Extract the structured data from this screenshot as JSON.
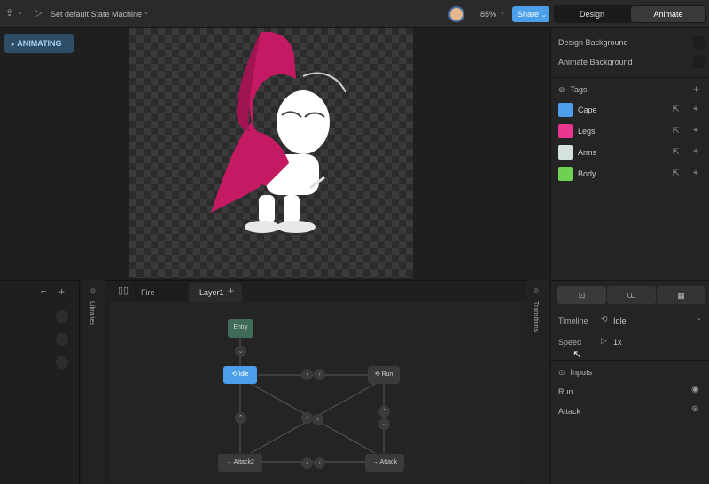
{
  "topbar": {
    "title": "Set default State Machine",
    "zoom": "85%",
    "share_label": "Share",
    "design_label": "Design",
    "animate_label": "Animate"
  },
  "stage": {
    "badge": "ANIMATING"
  },
  "right_panel": {
    "design_bg_label": "Design Background",
    "animate_bg_label": "Animate Background",
    "tags_title": "Tags",
    "tags": [
      {
        "label": "Cape",
        "color": "#4a9fe8"
      },
      {
        "label": "Legs",
        "color": "#e8368f"
      },
      {
        "label": "Arms",
        "color": "#d5e2dc"
      },
      {
        "label": "Body",
        "color": "#6fd150"
      }
    ],
    "timeline_label": "Timeline",
    "timeline_value": "Idle",
    "speed_label": "Speed",
    "speed_value": "1x",
    "inputs_title": "Inputs",
    "inputs": [
      {
        "label": "Run"
      },
      {
        "label": "Attack"
      }
    ]
  },
  "bottom": {
    "tab1": "Fire",
    "tab2": "Layer1",
    "libraries_label": "Libraries",
    "transitions_label": "Transitions",
    "nodes": {
      "entry": "Entry",
      "idle": "Idle",
      "run": "Run",
      "attack2": "Attack2",
      "attack": "Attack"
    }
  },
  "colors": {
    "accent": "#4a9fe8",
    "entry_node": "#3f6b58",
    "idle_node": "#4a9fe8",
    "cape": "#c41a64"
  }
}
